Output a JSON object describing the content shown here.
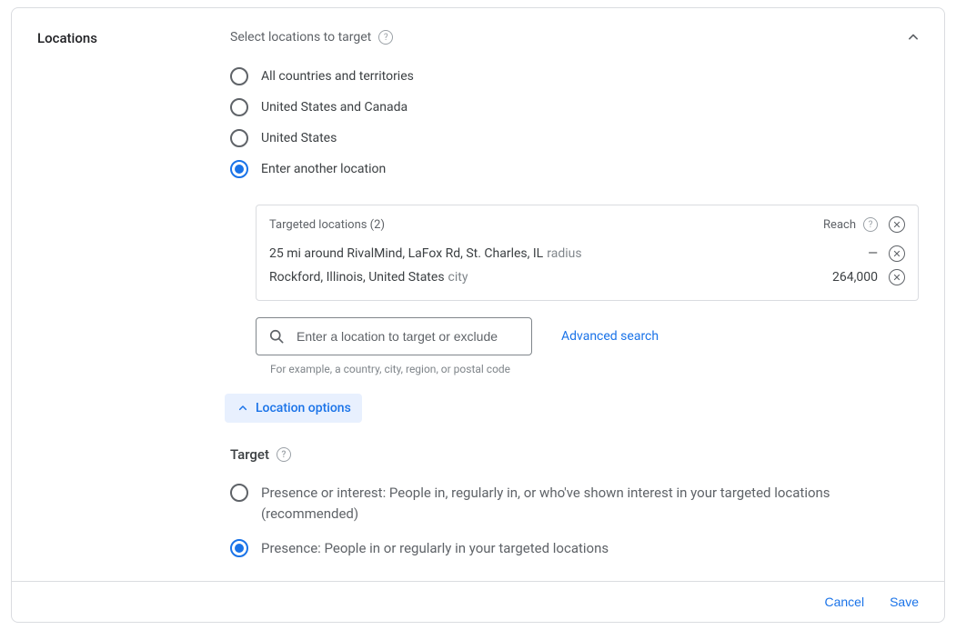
{
  "section_title": "Locations",
  "subheader": "Select locations to target",
  "radios": {
    "all": "All countries and territories",
    "us_ca": "United States and Canada",
    "us": "United States",
    "another": "Enter another location"
  },
  "targeted": {
    "header": "Targeted locations (2)",
    "reach_label": "Reach",
    "rows": [
      {
        "main": "25 mi around RivalMind, LaFox Rd, St. Charles, IL",
        "suffix": "radius",
        "reach": "—"
      },
      {
        "main": "Rockford, Illinois, United States",
        "suffix": "city",
        "reach": "264,000"
      }
    ]
  },
  "search": {
    "placeholder": "Enter a location to target or exclude",
    "hint": "For example, a country, city, region, or postal code",
    "advanced": "Advanced search"
  },
  "location_options_label": "Location options",
  "target": {
    "header": "Target",
    "options": {
      "presence_interest": "Presence or interest: People in, regularly in, or who've shown interest in your targeted locations (recommended)",
      "presence": "Presence: People in or regularly in your targeted locations"
    }
  },
  "footer": {
    "cancel": "Cancel",
    "save": "Save"
  }
}
